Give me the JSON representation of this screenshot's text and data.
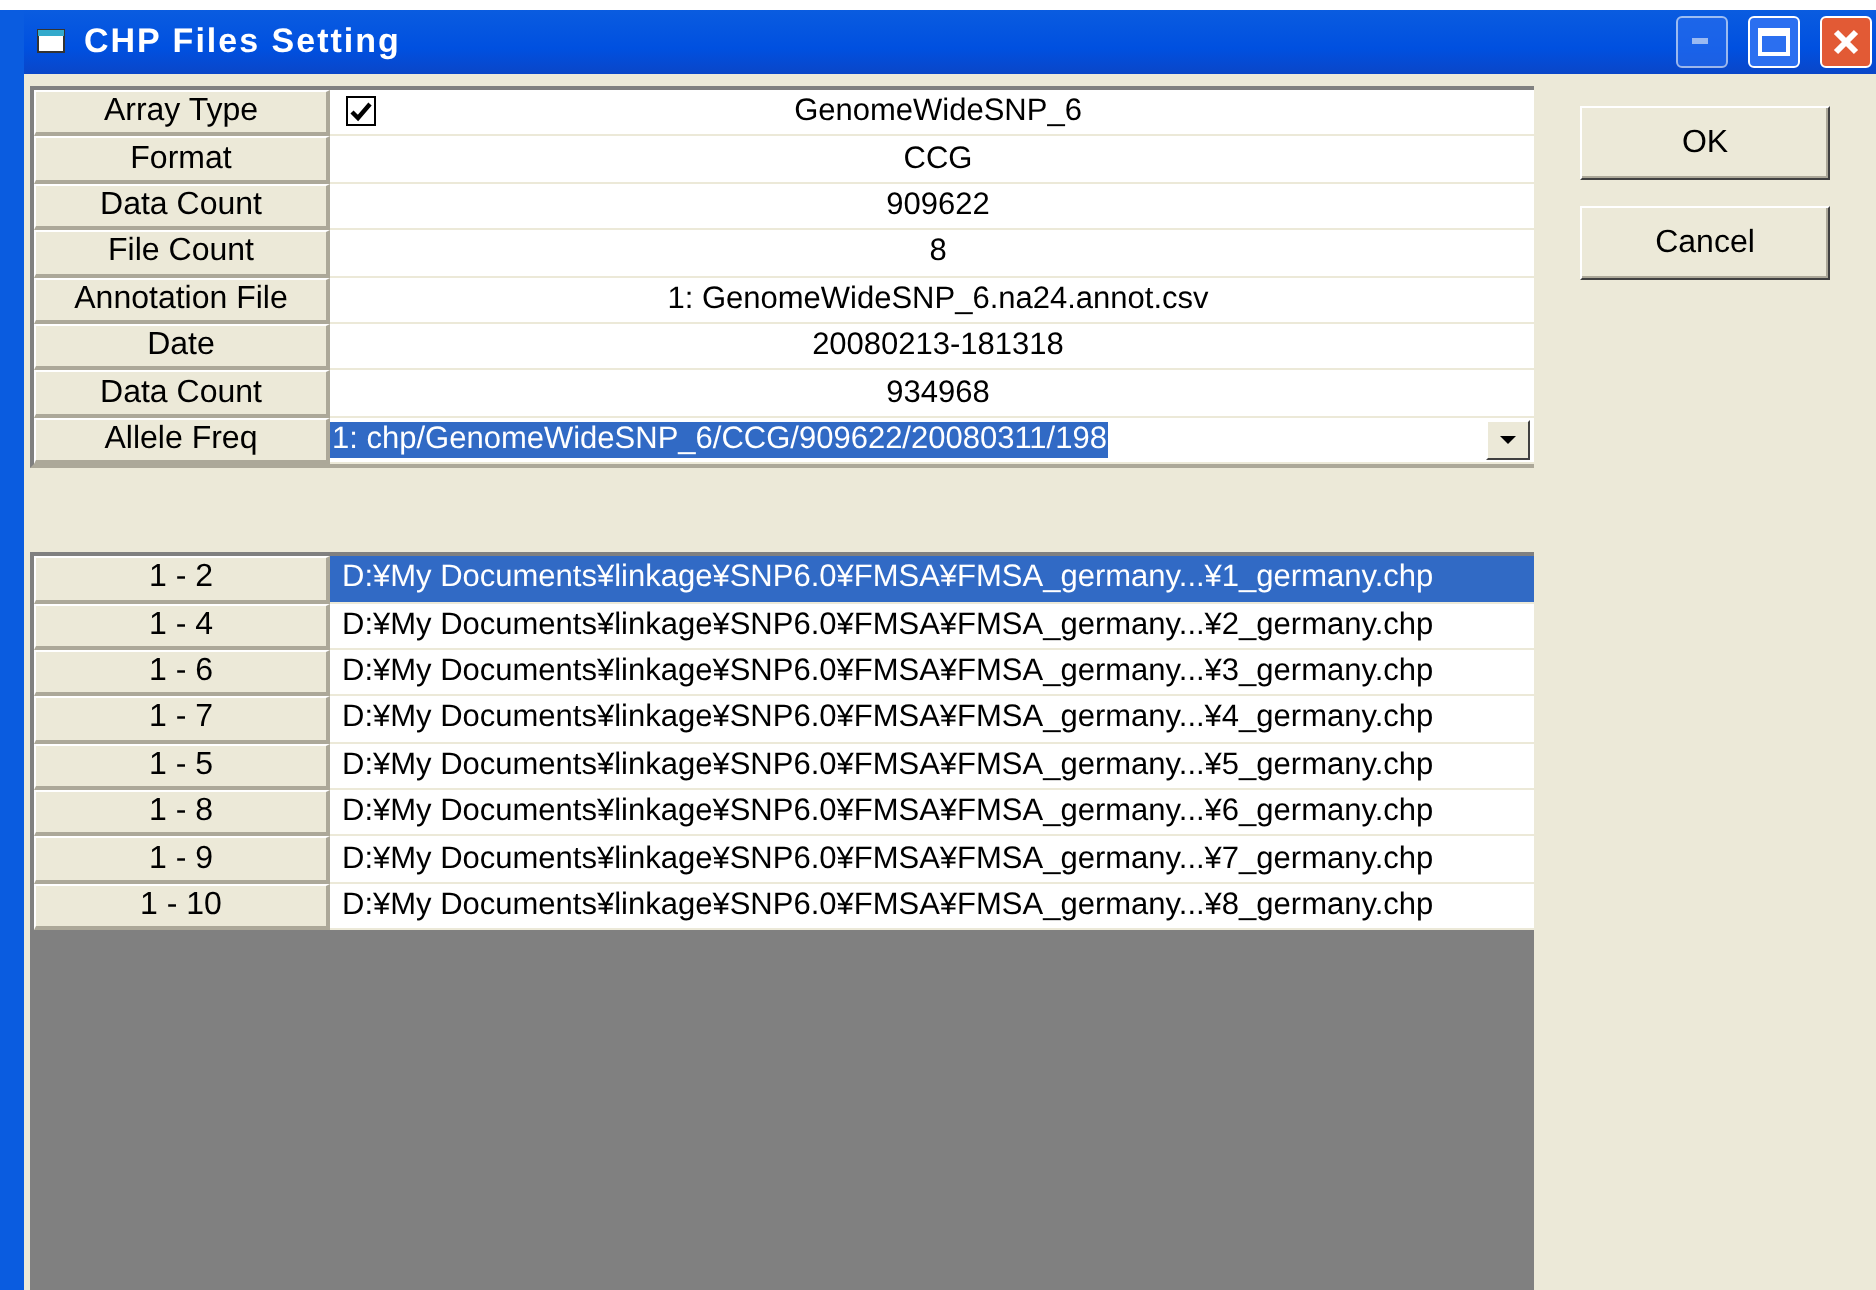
{
  "window": {
    "title": "CHP Files Setting"
  },
  "properties": [
    {
      "label": "Array Type",
      "kind": "checkbox",
      "checked": true,
      "value": "GenomeWideSNP_6"
    },
    {
      "label": "Format",
      "kind": "text",
      "value": "CCG"
    },
    {
      "label": "Data Count",
      "kind": "text",
      "value": "909622"
    },
    {
      "label": "File Count",
      "kind": "text",
      "value": "8"
    },
    {
      "label": "Annotation File",
      "kind": "text",
      "value": "1: GenomeWideSNP_6.na24.annot.csv"
    },
    {
      "label": "Date",
      "kind": "text",
      "value": "20080213-181318"
    },
    {
      "label": "Data Count",
      "kind": "text",
      "value": "934968"
    },
    {
      "label": "Allele Freq",
      "kind": "dropdown",
      "value": "1: chp/GenomeWideSNP_6/CCG/909622/20080311/198"
    }
  ],
  "files": [
    {
      "label": "1 - 2",
      "path": "D:¥My Documents¥linkage¥SNP6.0¥FMSA¥FMSA_germany...¥1_germany.chp",
      "selected": true
    },
    {
      "label": "1 - 4",
      "path": "D:¥My Documents¥linkage¥SNP6.0¥FMSA¥FMSA_germany...¥2_germany.chp",
      "selected": false
    },
    {
      "label": "1 - 6",
      "path": "D:¥My Documents¥linkage¥SNP6.0¥FMSA¥FMSA_germany...¥3_germany.chp",
      "selected": false
    },
    {
      "label": "1 - 7",
      "path": "D:¥My Documents¥linkage¥SNP6.0¥FMSA¥FMSA_germany...¥4_germany.chp",
      "selected": false
    },
    {
      "label": "1 - 5",
      "path": "D:¥My Documents¥linkage¥SNP6.0¥FMSA¥FMSA_germany...¥5_germany.chp",
      "selected": false
    },
    {
      "label": "1 - 8",
      "path": "D:¥My Documents¥linkage¥SNP6.0¥FMSA¥FMSA_germany...¥6_germany.chp",
      "selected": false
    },
    {
      "label": "1 - 9",
      "path": "D:¥My Documents¥linkage¥SNP6.0¥FMSA¥FMSA_germany...¥7_germany.chp",
      "selected": false
    },
    {
      "label": "1 - 10",
      "path": "D:¥My Documents¥linkage¥SNP6.0¥FMSA¥FMSA_germany...¥8_germany.chp",
      "selected": false
    }
  ],
  "buttons": [
    "OK",
    "Cancel"
  ]
}
